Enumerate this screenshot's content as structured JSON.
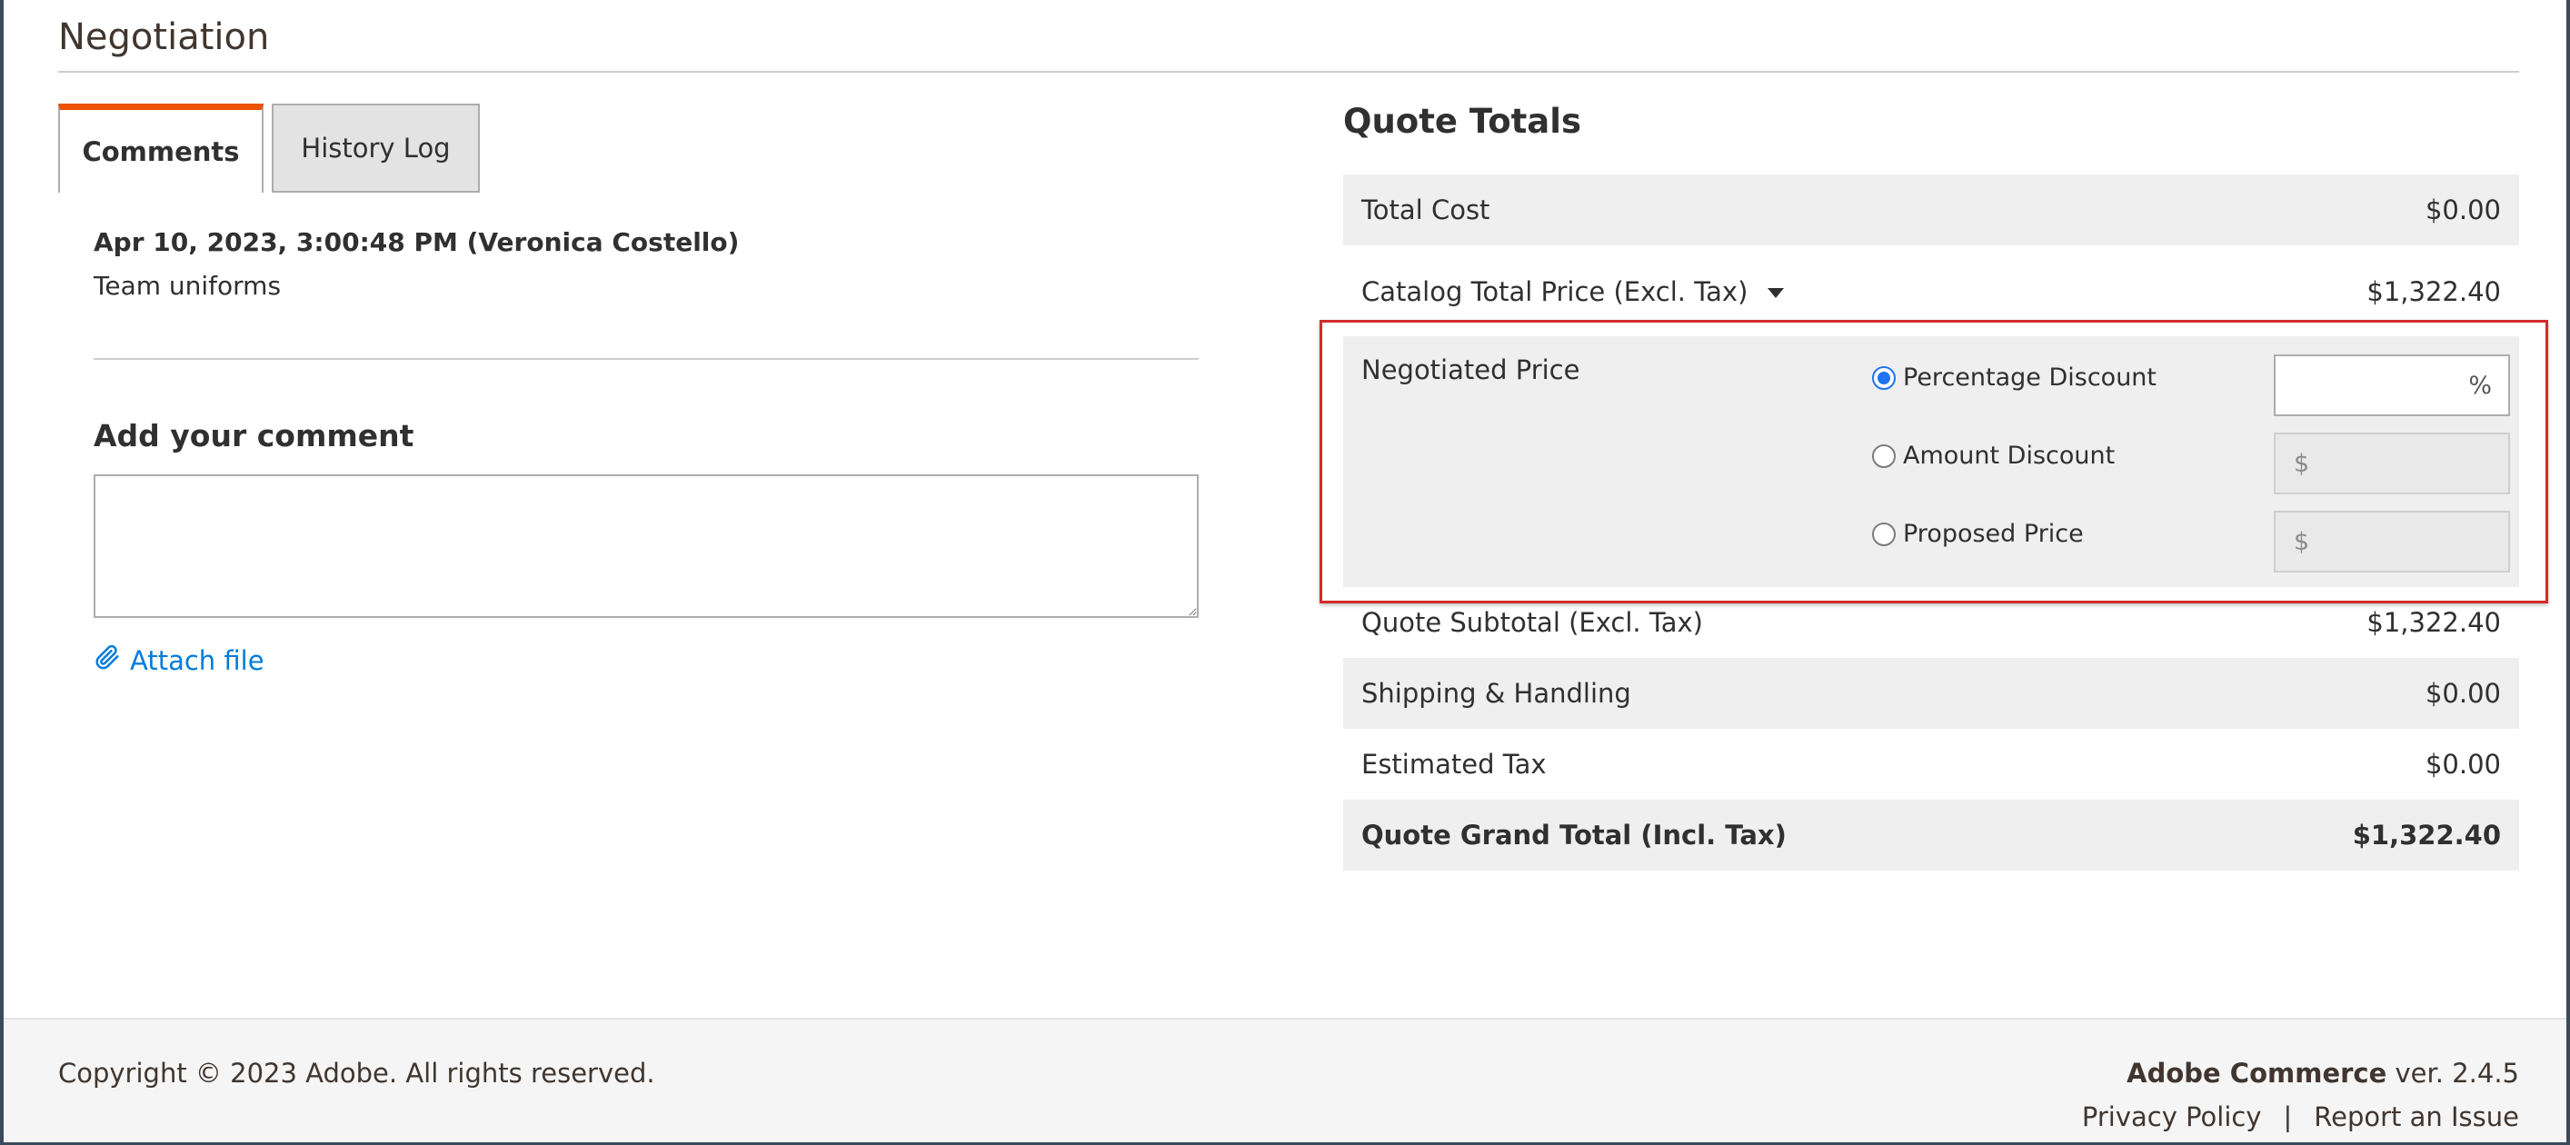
{
  "section": {
    "title": "Negotiation"
  },
  "tabs": [
    {
      "label": "Comments",
      "active": true
    },
    {
      "label": "History Log",
      "active": false
    }
  ],
  "comment": {
    "meta": "Apr 10, 2023, 3:00:48 PM (Veronica Costello)",
    "text": "Team uniforms"
  },
  "add_comment": {
    "title": "Add your comment",
    "textarea_value": "",
    "attach_label": "Attach file"
  },
  "quote_totals": {
    "title": "Quote Totals",
    "total_cost": {
      "label": "Total Cost",
      "value": "$0.00"
    },
    "catalog": {
      "label": "Catalog Total Price (Excl. Tax)",
      "value": "$1,322.40"
    },
    "negotiated": {
      "label": "Negotiated Price",
      "options": [
        {
          "label": "Percentage Discount",
          "checked": true,
          "unit": "%"
        },
        {
          "label": "Amount Discount",
          "checked": false,
          "unit": "$"
        },
        {
          "label": "Proposed Price",
          "checked": false,
          "unit": "$"
        }
      ]
    },
    "subtotal": {
      "label": "Quote Subtotal (Excl. Tax)",
      "value": "$1,322.40"
    },
    "shipping": {
      "label": "Shipping & Handling",
      "value": "$0.00"
    },
    "tax": {
      "label": "Estimated Tax",
      "value": "$0.00"
    },
    "grand_total": {
      "label": "Quote Grand Total (Incl. Tax)",
      "value": "$1,322.40"
    }
  },
  "footer": {
    "copyright": "Copyright © 2023 Adobe. All rights reserved.",
    "brand": "Adobe Commerce",
    "version": "ver. 2.4.5",
    "links": [
      "Privacy Policy",
      "Report an Issue"
    ],
    "separator": "|"
  },
  "colors": {
    "accent": "#eb5202",
    "link": "#007bdb",
    "radio": "#1e73f0",
    "highlight": "#d52b2b"
  }
}
